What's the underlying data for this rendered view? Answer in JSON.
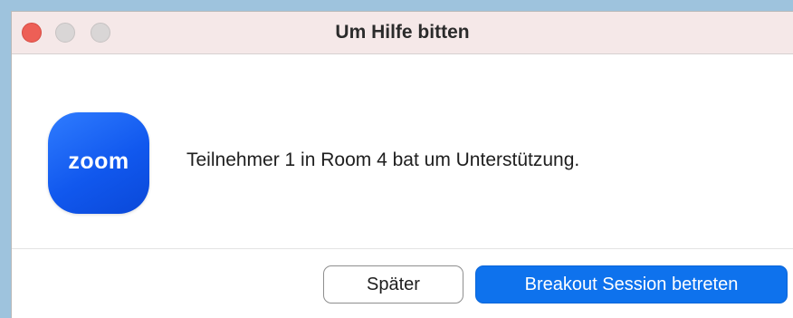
{
  "window": {
    "title": "Um Hilfe bitten"
  },
  "logo": {
    "text": "zoom",
    "icon": "zoom-app-logo"
  },
  "message": "Teilnehmer 1 in Room 4 bat um Unterstützung.",
  "buttons": {
    "later_label": "Später",
    "join_label": "Breakout Session betreten"
  },
  "colors": {
    "primary": "#0e72ed",
    "close": "#ed5f56",
    "logo": "#1158ee"
  }
}
